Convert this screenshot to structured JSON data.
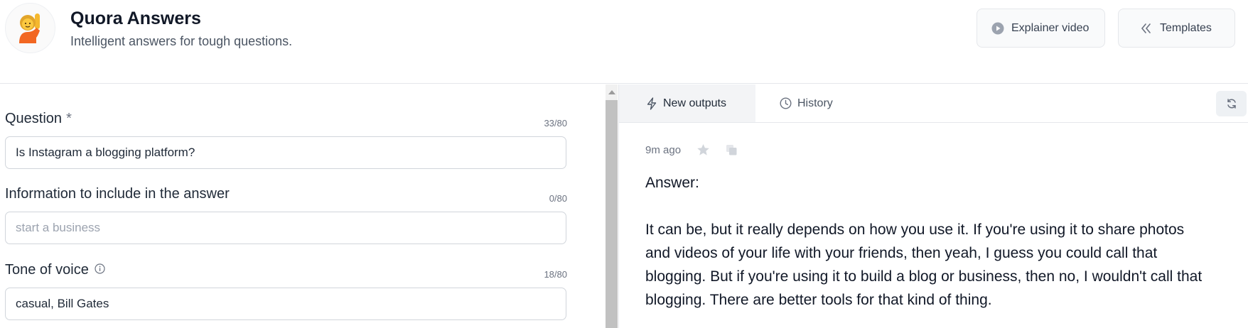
{
  "header": {
    "title": "Quora Answers",
    "subtitle": "Intelligent answers for tough questions.",
    "logo_icon": "person-raising-hand-icon",
    "buttons": {
      "video": "Explainer video",
      "templates": "Templates"
    }
  },
  "form": {
    "question": {
      "label": "Question",
      "required_mark": "*",
      "counter": "33/80",
      "value": "Is Instagram a blogging platform?"
    },
    "info": {
      "label": "Information to include in the answer",
      "counter": "0/80",
      "value": "",
      "placeholder": "start a business"
    },
    "tone": {
      "label": "Tone of voice",
      "counter": "18/80",
      "value": "casual, Bill Gates"
    }
  },
  "output_panel": {
    "tabs": {
      "new": "New outputs",
      "history": "History"
    },
    "time": "9m ago",
    "answer_heading": "Answer:",
    "answer_lines": [
      "It can be, but it really depends on how you use it. If you're using it to share photos",
      "and videos of your life with your friends, then yeah, I guess you could call that",
      "blogging. But if you're using it to build a blog or business, then no, I wouldn't call that",
      "blogging. There are better tools for that kind of thing."
    ]
  },
  "colors": {
    "accent_text": "#111827",
    "muted": "#6b7280",
    "border": "#e5e7eb"
  }
}
